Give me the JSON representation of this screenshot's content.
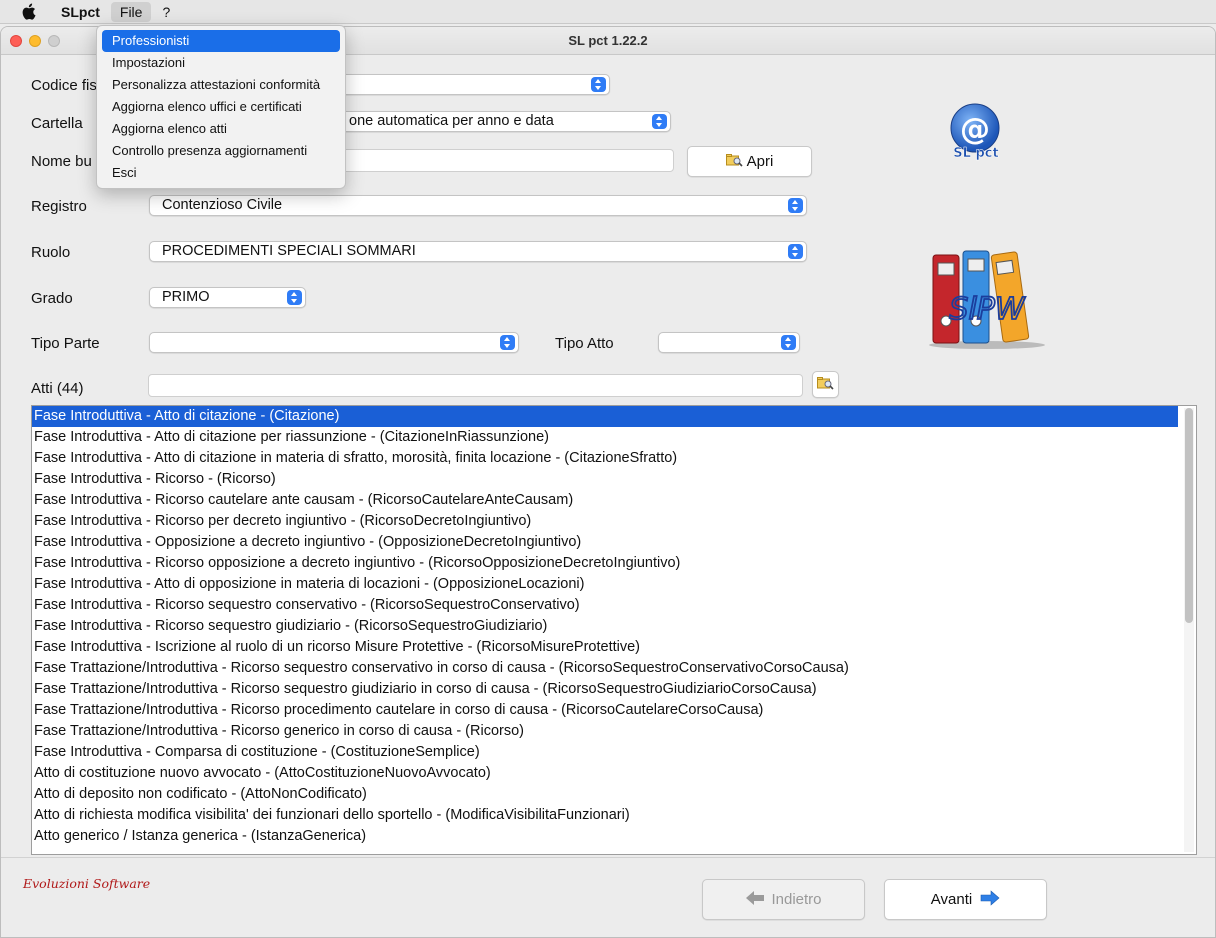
{
  "menubar": {
    "app_name": "SLpct",
    "menus": [
      "File",
      "?"
    ]
  },
  "window": {
    "title": "SL pct 1.22.2"
  },
  "file_menu": {
    "items": [
      "Professionisti",
      "Impostazioni",
      "Personalizza attestazioni conformità",
      "Aggiorna elenco uffici e certificati",
      "Aggiorna elenco atti",
      "Controllo presenza aggiornamenti",
      "Esci"
    ],
    "highlighted": "Professionisti"
  },
  "form": {
    "codice_fiscale_label": "Codice fis",
    "cartella_label": "Cartella",
    "cartella_value": "one automatica per anno e data",
    "nome_busta_label": "Nome bu",
    "apri_button": "Apri",
    "registro_label": "Registro",
    "registro_value": "Contenzioso Civile",
    "ruolo_label": "Ruolo",
    "ruolo_value": "PROCEDIMENTI SPECIALI SOMMARI",
    "grado_label": "Grado",
    "grado_value": "PRIMO",
    "tipo_parte_label": "Tipo Parte",
    "tipo_atto_label": "Tipo Atto",
    "atti_label": "Atti (44)"
  },
  "logo": {
    "text": "SL pct",
    "at": "@",
    "slpw": "SlPW"
  },
  "atti_list": [
    "Fase Introduttiva - Atto di citazione - (Citazione)",
    "Fase Introduttiva - Atto di citazione per riassunzione - (CitazioneInRiassunzione)",
    "Fase Introduttiva - Atto di citazione in materia di sfratto, morosità, finita locazione - (CitazioneSfratto)",
    "Fase Introduttiva - Ricorso - (Ricorso)",
    "Fase Introduttiva - Ricorso cautelare ante causam - (RicorsoCautelareAnteCausam)",
    "Fase Introduttiva - Ricorso per decreto ingiuntivo - (RicorsoDecretoIngiuntivo)",
    "Fase Introduttiva - Opposizione a decreto ingiuntivo - (OpposizioneDecretoIngiuntivo)",
    "Fase Introduttiva - Ricorso opposizione a decreto ingiuntivo - (RicorsoOpposizioneDecretoIngiuntivo)",
    "Fase Introduttiva - Atto di opposizione in materia di locazioni - (OpposizioneLocazioni)",
    "Fase Introduttiva - Ricorso sequestro conservativo - (RicorsoSequestroConservativo)",
    "Fase Introduttiva - Ricorso sequestro giudiziario - (RicorsoSequestroGiudiziario)",
    "Fase Introduttiva - Iscrizione al ruolo di un ricorso Misure Protettive - (RicorsoMisureProtettive)",
    "Fase Trattazione/Introduttiva - Ricorso sequestro conservativo in corso di causa - (RicorsoSequestroConservativoCorsoCausa)",
    "Fase Trattazione/Introduttiva - Ricorso sequestro giudiziario in corso di causa - (RicorsoSequestroGiudiziarioCorsoCausa)",
    "Fase Trattazione/Introduttiva - Ricorso procedimento cautelare in corso di causa - (RicorsoCautelareCorsoCausa)",
    "Fase Trattazione/Introduttiva - Ricorso generico in corso di causa - (Ricorso)",
    "Fase Introduttiva - Comparsa di costituzione - (CostituzioneSemplice)",
    "Atto di costituzione nuovo avvocato - (AttoCostituzioneNuovoAvvocato)",
    "Atto di deposito non codificato - (AttoNonCodificato)",
    "Atto di richiesta modifica visibilita' dei funzionari dello sportello - (ModificaVisibilitaFunzionari)",
    "Atto generico / Istanza generica - (IstanzaGenerica)"
  ],
  "footer": {
    "brand": "Evoluzioni Software",
    "back_button": "Indietro",
    "next_button": "Avanti"
  },
  "colors": {
    "selection": "#1a5fd6",
    "select_arrow": "#2f7cf6",
    "brand": "#b01818"
  }
}
